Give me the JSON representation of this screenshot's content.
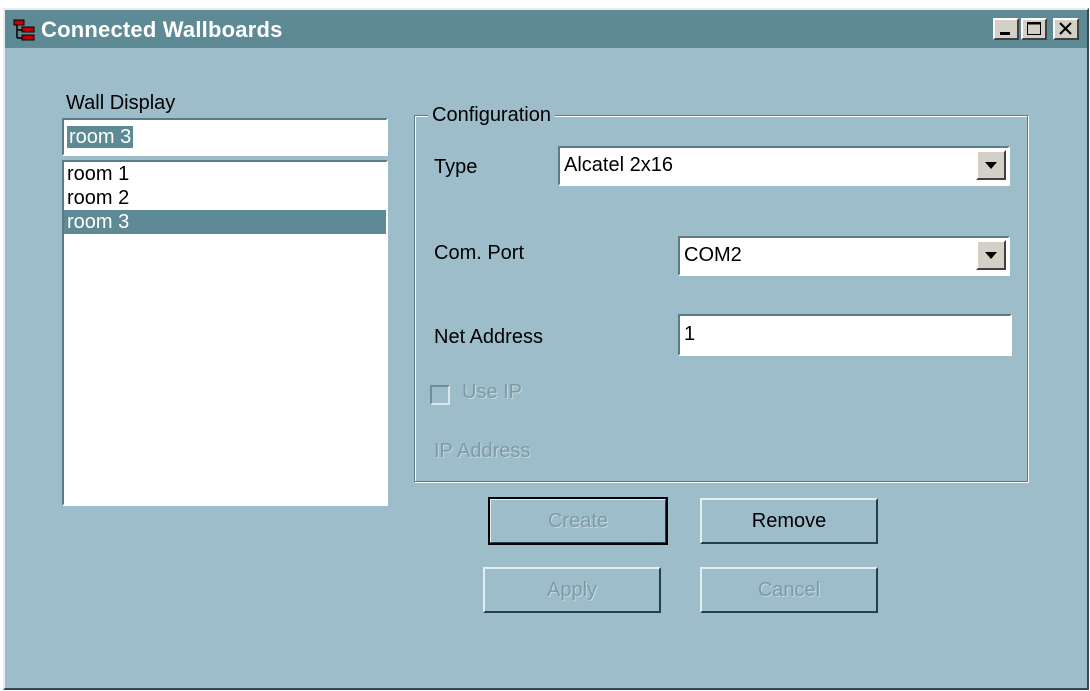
{
  "window": {
    "title": "Connected Wallboards"
  },
  "wall_display": {
    "label": "Wall Display",
    "name_value": "room 3",
    "items": [
      {
        "label": "room 1",
        "selected": false
      },
      {
        "label": "room 2",
        "selected": false
      },
      {
        "label": "room 3",
        "selected": true
      }
    ]
  },
  "configuration": {
    "legend": "Configuration",
    "type_label": "Type",
    "type_value": "Alcatel 2x16",
    "port_label": "Com. Port",
    "port_value": "COM2",
    "net_label": "Net Address",
    "net_value": "1",
    "use_ip_label": "Use IP",
    "use_ip_checked": false,
    "ip_label": "IP Address"
  },
  "buttons": {
    "create": "Create",
    "remove": "Remove",
    "apply": "Apply",
    "cancel": "Cancel"
  },
  "colors": {
    "window_bg": "#9dbdca",
    "titlebar": "#5e8a96",
    "selection": "#5e8a96",
    "disabled_text": "#7d9aa6"
  }
}
